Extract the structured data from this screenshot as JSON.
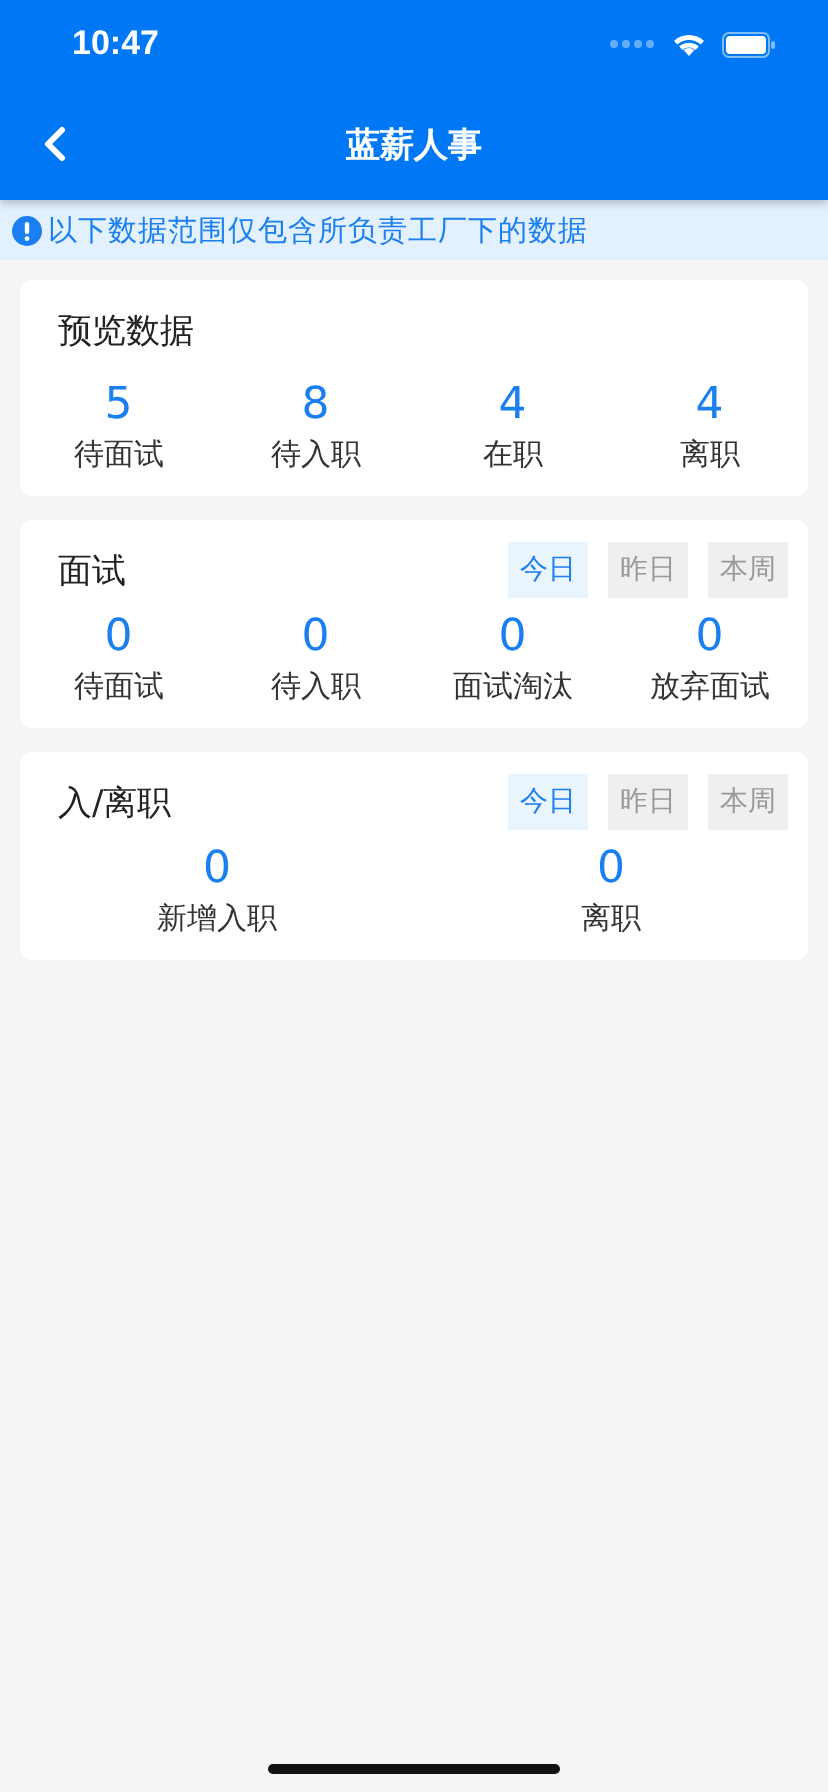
{
  "status_bar": {
    "time": "10:47"
  },
  "nav": {
    "title": "蓝薪人事"
  },
  "notice": {
    "text": "以下数据范围仅包含所负责工厂下的数据"
  },
  "cards": [
    {
      "title": "预览数据",
      "stats": [
        {
          "value": "5",
          "label": "待面试"
        },
        {
          "value": "8",
          "label": "待入职"
        },
        {
          "value": "4",
          "label": "在职"
        },
        {
          "value": "4",
          "label": "离职"
        }
      ]
    },
    {
      "title": "面试",
      "filters": [
        {
          "label": "今日",
          "selected": true
        },
        {
          "label": "昨日",
          "selected": false
        },
        {
          "label": "本周",
          "selected": false
        }
      ],
      "stats": [
        {
          "value": "0",
          "label": "待面试"
        },
        {
          "value": "0",
          "label": "待入职"
        },
        {
          "value": "0",
          "label": "面试淘汰"
        },
        {
          "value": "0",
          "label": "放弃面试"
        }
      ]
    },
    {
      "title": "入/离职",
      "filters": [
        {
          "label": "今日",
          "selected": true
        },
        {
          "label": "昨日",
          "selected": false
        },
        {
          "label": "本周",
          "selected": false
        }
      ],
      "stats": [
        {
          "value": "0",
          "label": "新增入职"
        },
        {
          "value": "0",
          "label": "离职"
        }
      ]
    }
  ]
}
